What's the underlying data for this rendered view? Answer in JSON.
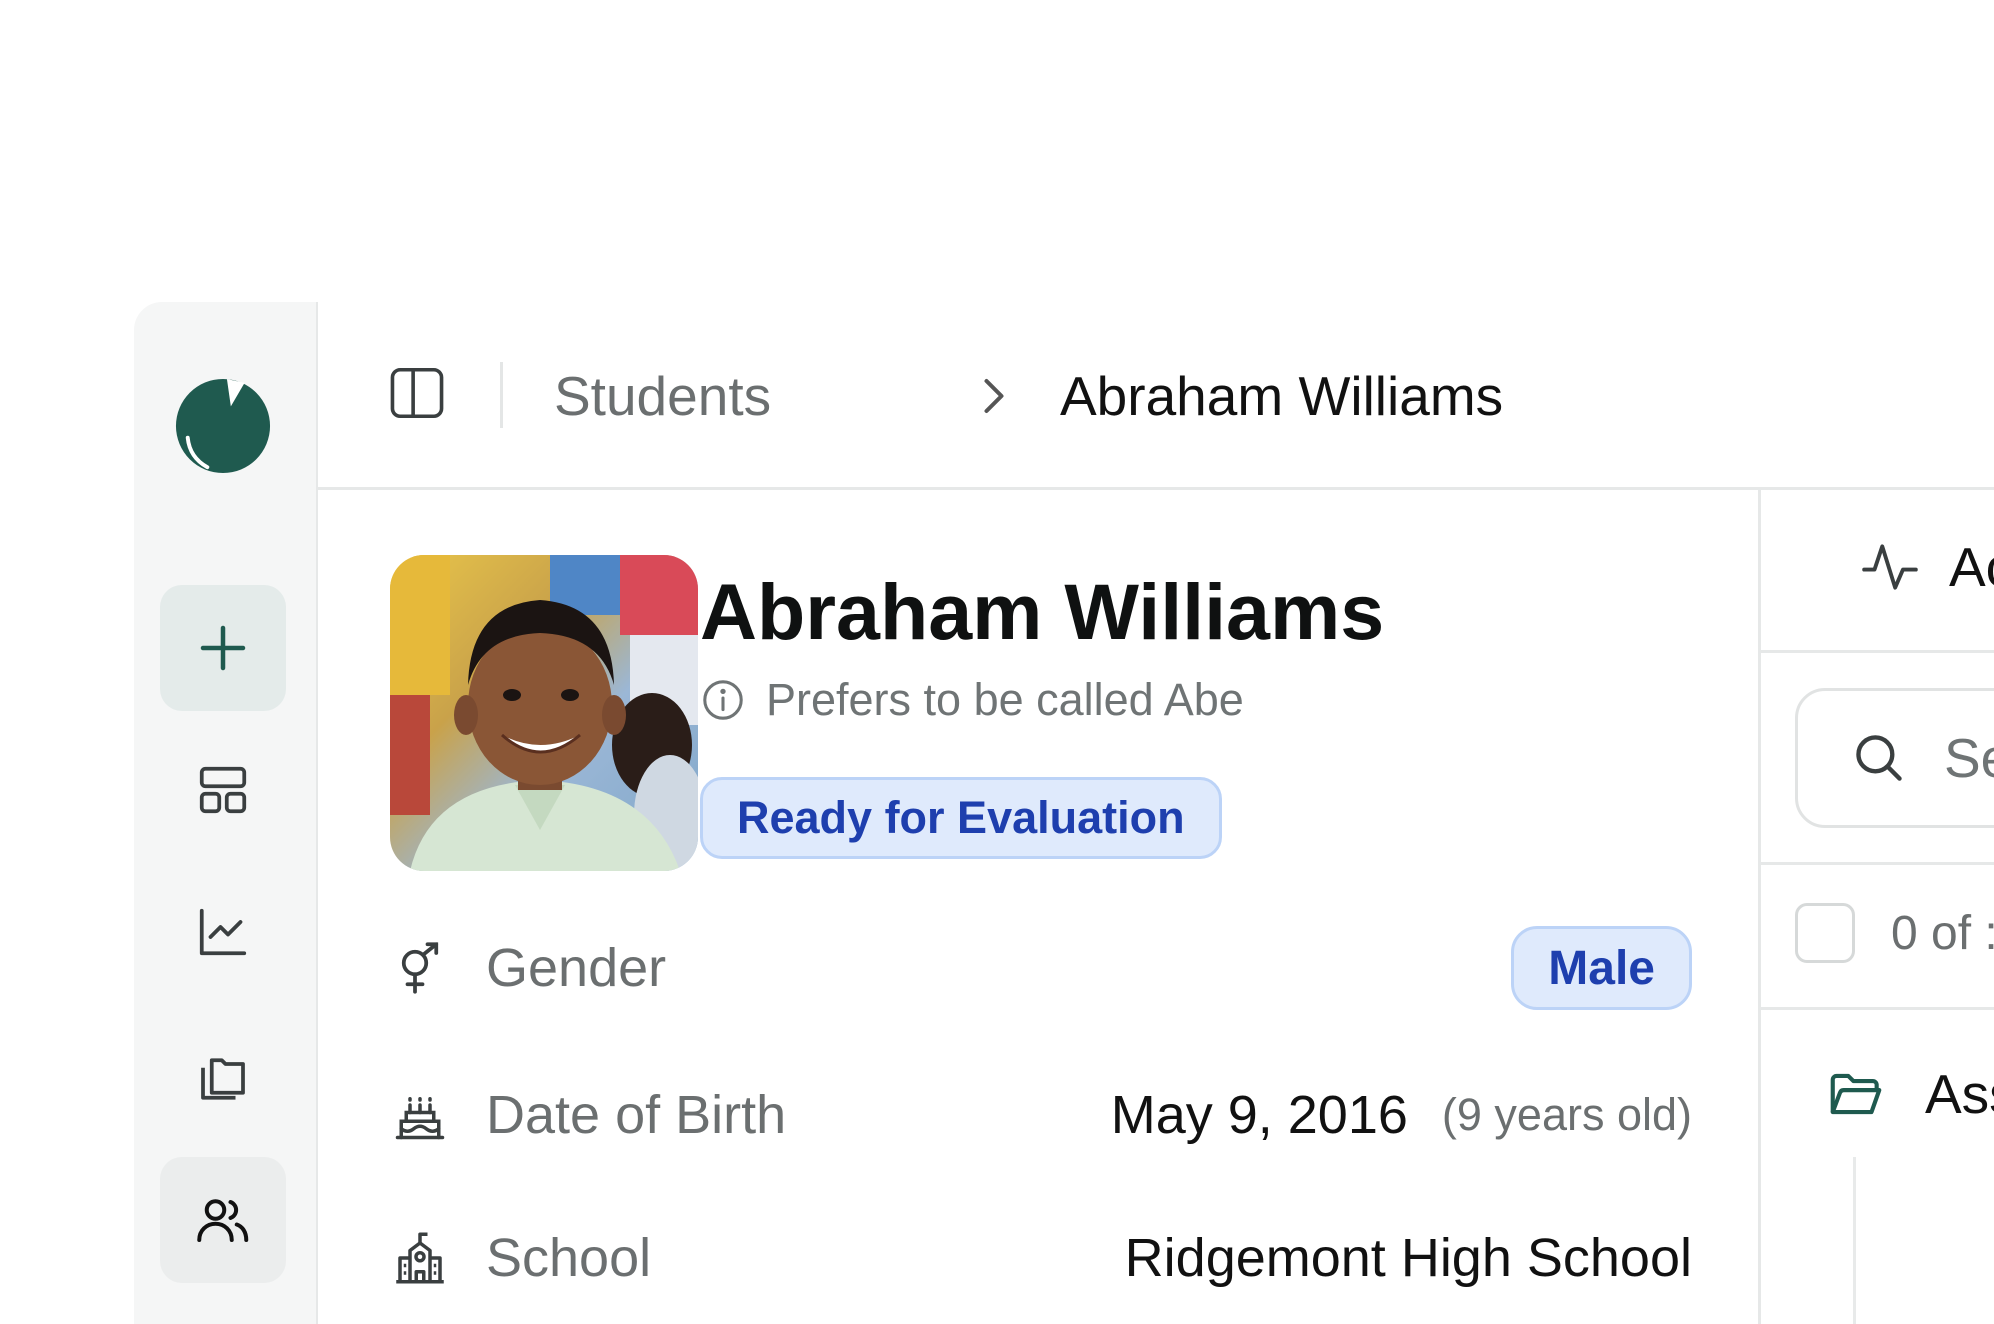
{
  "app": {
    "brand_color": "#1f5a4f",
    "accent_blue": "#1e3fae",
    "badge_bg": "#dfeafc"
  },
  "sidebar": {
    "items": [
      {
        "name": "new",
        "icon": "plus-icon"
      },
      {
        "name": "dashboard",
        "icon": "layout-grid-icon"
      },
      {
        "name": "analytics",
        "icon": "line-chart-icon"
      },
      {
        "name": "files",
        "icon": "copy-stack-icon"
      },
      {
        "name": "students",
        "icon": "users-icon",
        "active": true
      }
    ]
  },
  "header": {
    "breadcrumb_parent": "Students",
    "breadcrumb_current": "Abraham Williams"
  },
  "student": {
    "name": "Abraham Williams",
    "nickname": "Prefers to be called Abe",
    "status": "Ready for Evaluation",
    "fields": {
      "gender_label": "Gender",
      "gender_value": "Male",
      "dob_label": "Date of Birth",
      "dob_value": "May 9, 2016",
      "dob_age": "(9 years old)",
      "school_label": "School",
      "school_value": "Ridgemont High School"
    }
  },
  "right_panel": {
    "tab_label": "Ac",
    "search_placeholder": "Se",
    "selection_count": "0 of :",
    "folder_label": "Ass"
  }
}
